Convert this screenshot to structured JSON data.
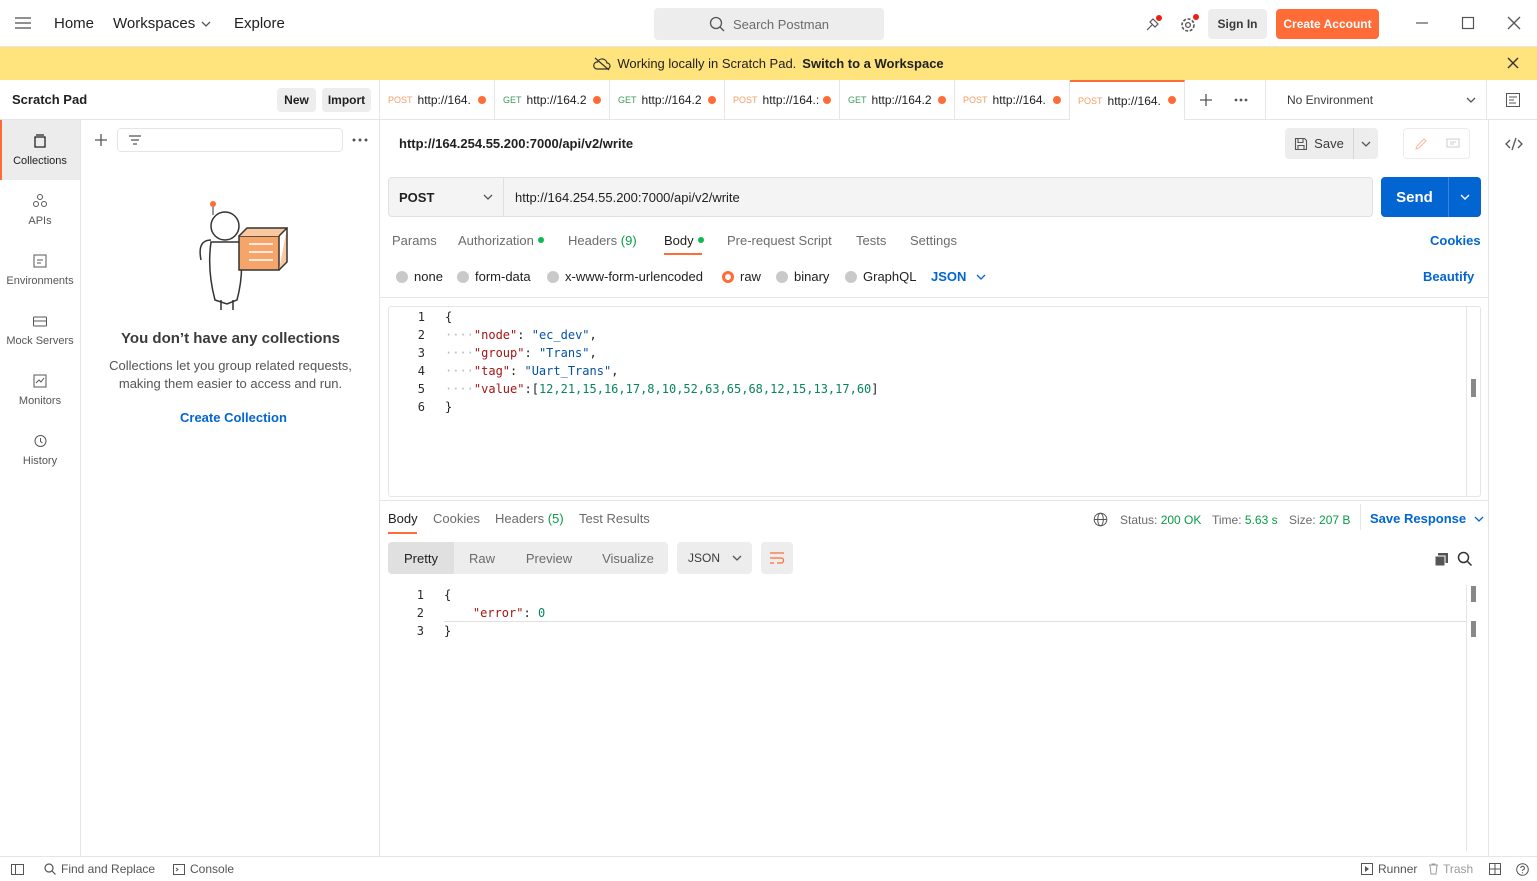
{
  "topbar": {
    "home": "Home",
    "workspaces": "Workspaces",
    "explore": "Explore",
    "search_placeholder": "Search Postman",
    "sign_in": "Sign In",
    "create_account": "Create Account"
  },
  "banner": {
    "text": "Working locally in Scratch Pad.",
    "link": "Switch to a Workspace"
  },
  "sidebar": {
    "title": "Scratch Pad",
    "new_label": "New",
    "import_label": "Import",
    "rail": [
      {
        "label": "Collections",
        "icon": "collections-icon"
      },
      {
        "label": "APIs",
        "icon": "apis-icon"
      },
      {
        "label": "Environments",
        "icon": "environments-icon"
      },
      {
        "label": "Mock Servers",
        "icon": "mock-servers-icon"
      },
      {
        "label": "Monitors",
        "icon": "monitors-icon"
      },
      {
        "label": "History",
        "icon": "history-icon"
      }
    ],
    "empty_title": "You don’t have any collections",
    "empty_desc_1": "Collections let you group related requests,",
    "empty_desc_2": "making them easier to access and run.",
    "create_collection": "Create Collection"
  },
  "tabs": [
    {
      "method": "POST",
      "url": "http://164."
    },
    {
      "method": "GET",
      "url": "http://164.2"
    },
    {
      "method": "GET",
      "url": "http://164.2"
    },
    {
      "method": "POST",
      "url": "http://164.:"
    },
    {
      "method": "GET",
      "url": "http://164.2"
    },
    {
      "method": "POST",
      "url": "http://164."
    },
    {
      "method": "POST",
      "url": "http://164."
    }
  ],
  "environment": "No Environment",
  "request": {
    "title": "http://164.254.55.200:7000/api/v2/write",
    "save": "Save",
    "method": "POST",
    "url": "http://164.254.55.200:7000/api/v2/write",
    "send": "Send",
    "subtabs": {
      "params": "Params",
      "authorization": "Authorization",
      "headers": "Headers",
      "headers_count": "(9)",
      "body": "Body",
      "prerequest": "Pre-request Script",
      "tests": "Tests",
      "settings": "Settings",
      "cookies": "Cookies"
    },
    "body_types": {
      "none": "none",
      "form_data": "form-data",
      "urlencoded": "x-www-form-urlencoded",
      "raw": "raw",
      "binary": "binary",
      "graphql": "GraphQL",
      "format": "JSON",
      "beautify": "Beautify"
    },
    "body_lines": {
      "l1": "1",
      "l2": "2",
      "l3": "3",
      "l4": "4",
      "l5": "5",
      "l6": "6",
      "open": "{",
      "node_key": "\"node\"",
      "node_val": "\"ec_dev\"",
      "group_key": "\"group\"",
      "group_val": "\"Trans\"",
      "tag_key": "\"tag\"",
      "tag_val": "\"Uart_Trans\"",
      "value_key": "\"value\"",
      "value_val": "12,21,15,16,17,8,10,52,63,65,68,12,15,13,17,60",
      "close": "}"
    }
  },
  "response": {
    "tabs": {
      "body": "Body",
      "cookies": "Cookies",
      "headers": "Headers",
      "headers_count": "(5)",
      "test_results": "Test Results"
    },
    "status_label": "Status:",
    "status_value": "200 OK",
    "time_label": "Time:",
    "time_value": "5.63 s",
    "size_label": "Size:",
    "size_value": "207 B",
    "save_response": "Save Response",
    "views": {
      "pretty": "Pretty",
      "raw": "Raw",
      "preview": "Preview",
      "visualize": "Visualize"
    },
    "format": "JSON",
    "lines": {
      "l1": "1",
      "l2": "2",
      "l3": "3",
      "open": "{",
      "error_key": "\"error\"",
      "error_val": "0",
      "close": "}"
    }
  },
  "bottombar": {
    "find_replace": "Find and Replace",
    "console": "Console",
    "runner": "Runner",
    "trash": "Trash"
  },
  "colors": {
    "accent": "#ff6c37",
    "send": "#0265d2",
    "banner": "#ffe47e",
    "link": "#0265d2",
    "status_ok": "#0cbb52"
  }
}
